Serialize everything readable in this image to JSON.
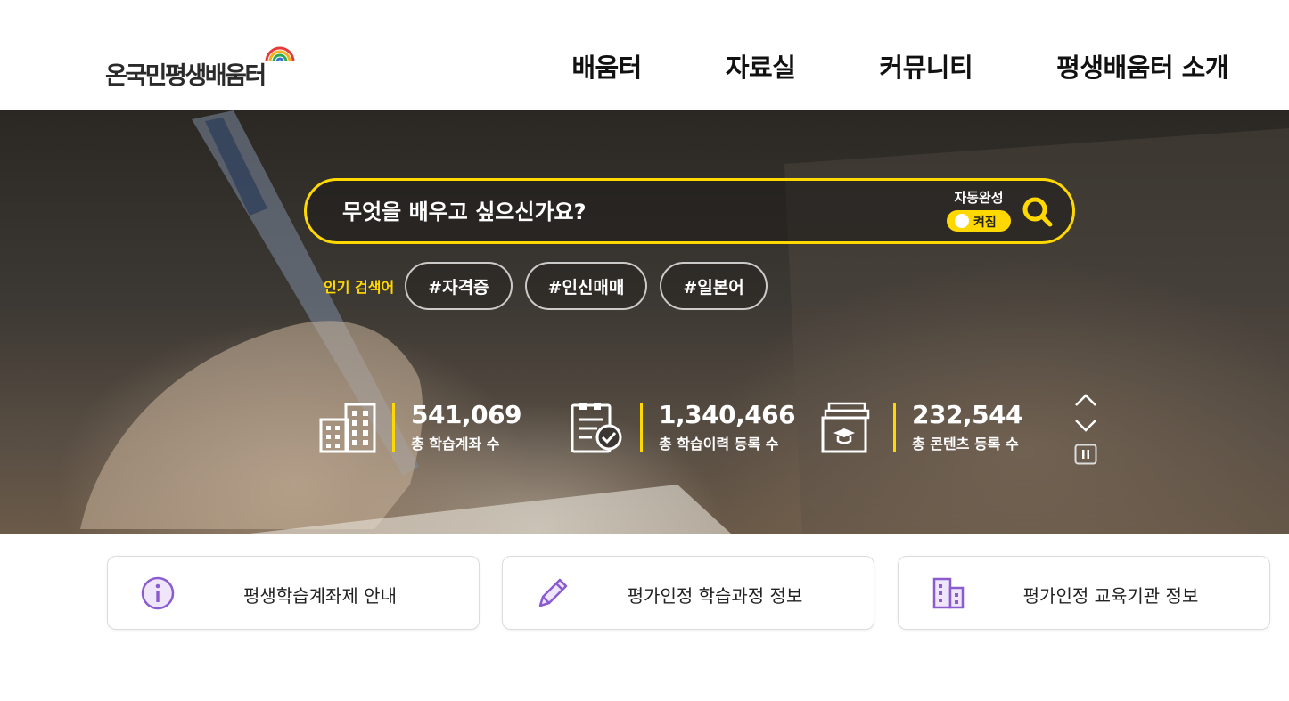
{
  "header": {
    "logo_text": "온국민평생배움터",
    "nav": [
      "배움터",
      "자료실",
      "커뮤니티",
      "평생배움터 소개"
    ]
  },
  "hero": {
    "search": {
      "placeholder": "무엇을 배우고 싶으신가요?",
      "autocomplete_label": "자동완성",
      "autocomplete_state": "켜짐"
    },
    "popular": {
      "label": "인기 검색어",
      "tags": [
        "#자격증",
        "#인신매매",
        "#일본어"
      ]
    },
    "stats": [
      {
        "value": "541,069",
        "label": "총 학습계좌 수",
        "icon": "building-icon"
      },
      {
        "value": "1,340,466",
        "label": "총 학습이력 등록 수",
        "icon": "clipboard-check-icon"
      },
      {
        "value": "232,544",
        "label": "총 콘텐츠 등록 수",
        "icon": "folder-graduation-icon"
      }
    ]
  },
  "quick_links": [
    {
      "label": "평생학습계좌제 안내",
      "icon": "info-icon"
    },
    {
      "label": "평가인정 학습과정 정보",
      "icon": "pencil-icon"
    },
    {
      "label": "평가인정 교육기관 정보",
      "icon": "building-icon"
    }
  ],
  "colors": {
    "accent": "#ffd800",
    "icon_purple": "#8a5cd0"
  }
}
